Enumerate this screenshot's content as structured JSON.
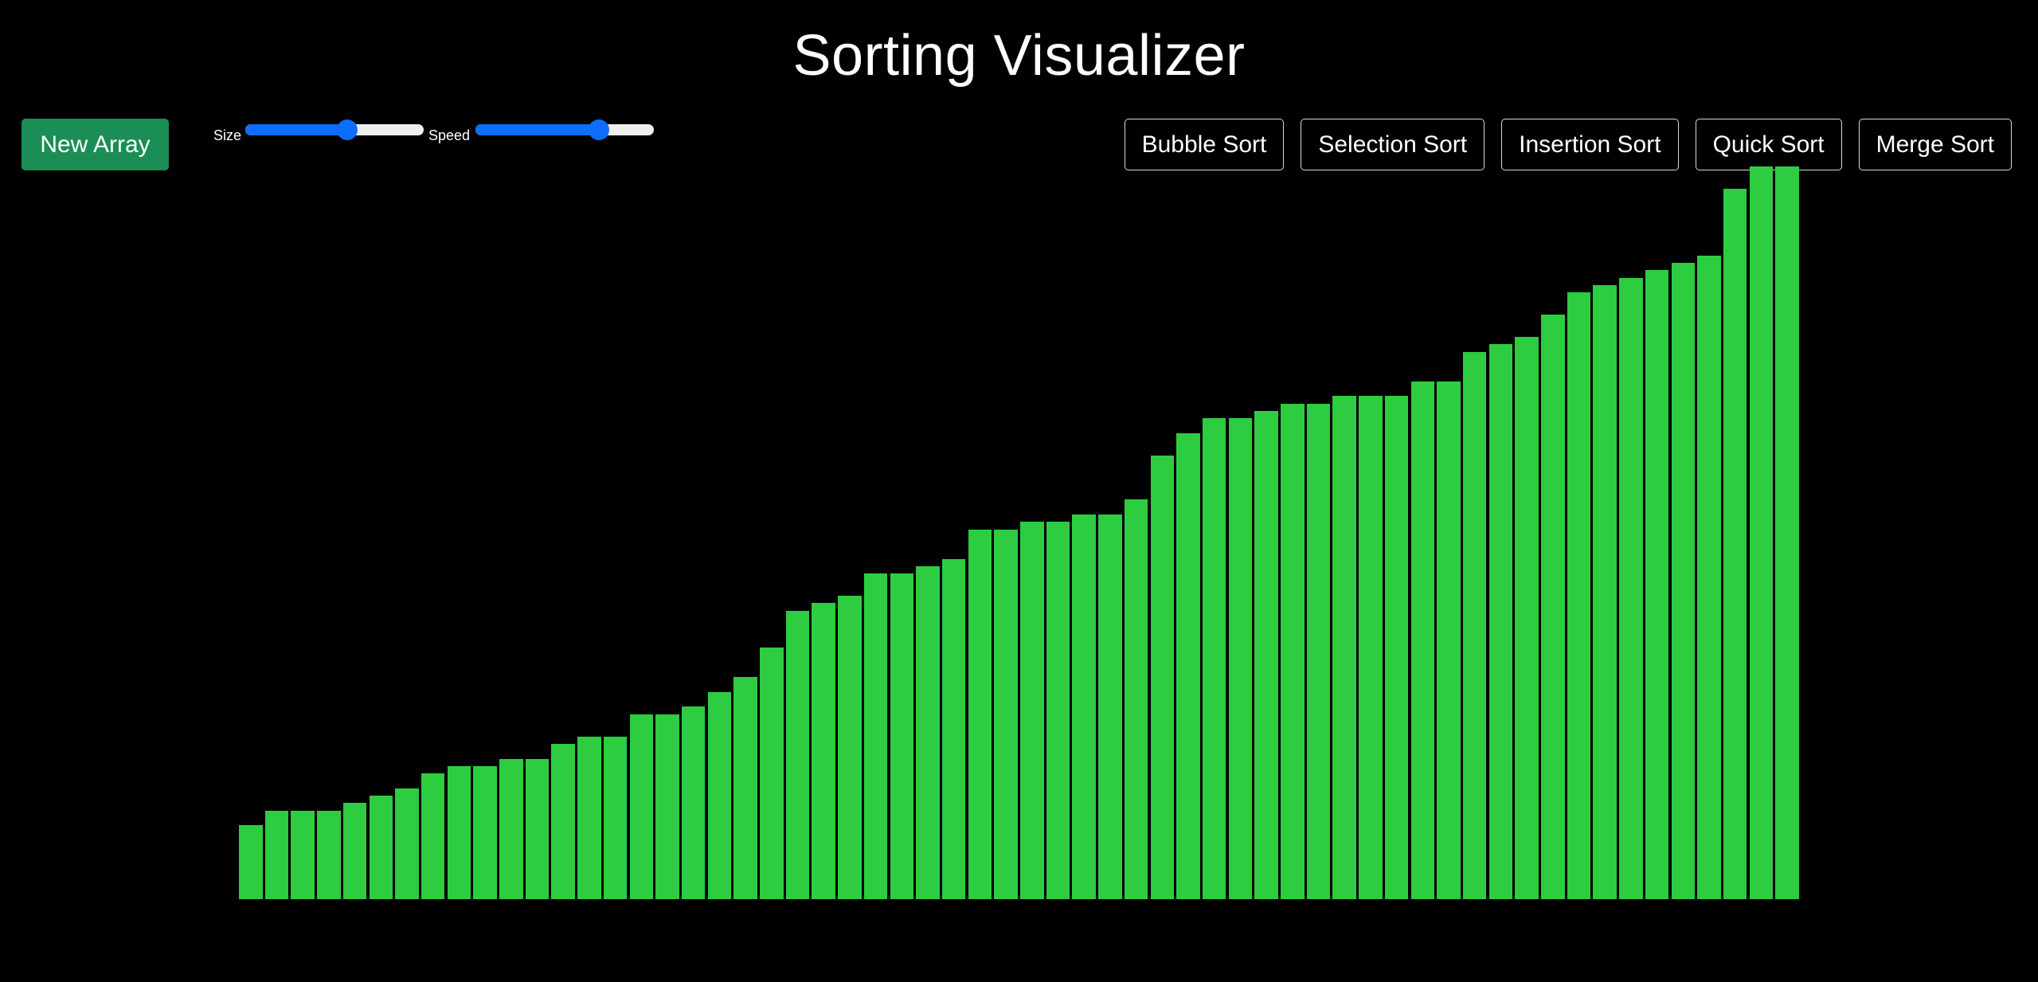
{
  "header": {
    "title": "Sorting Visualizer"
  },
  "controls": {
    "new_array_label": "New Array",
    "size_label": "Size",
    "speed_label": "Speed",
    "size_level": 0.57,
    "speed_level": 0.69
  },
  "algorithms": [
    {
      "label": "Bubble Sort"
    },
    {
      "label": "Selection Sort"
    },
    {
      "label": "Insertion Sort"
    },
    {
      "label": "Quick Sort"
    },
    {
      "label": "Merge Sort"
    }
  ],
  "colors": {
    "background": "#000000",
    "new_array_button": "#1b8e55",
    "slider_accent": "#0d6efd",
    "bar": "#2ecc40"
  },
  "chart_data": {
    "type": "bar",
    "max_value": 700,
    "values": [
      70,
      84,
      84,
      84,
      91,
      98,
      105,
      119,
      126,
      126,
      133,
      133,
      147,
      154,
      154,
      175,
      175,
      182,
      196,
      210,
      238,
      273,
      280,
      287,
      308,
      308,
      315,
      322,
      350,
      350,
      357,
      357,
      364,
      364,
      378,
      420,
      441,
      455,
      455,
      462,
      469,
      469,
      476,
      476,
      476,
      490,
      490,
      518,
      525,
      532,
      553,
      574,
      581,
      588,
      595,
      602,
      609,
      672,
      693,
      693
    ]
  }
}
